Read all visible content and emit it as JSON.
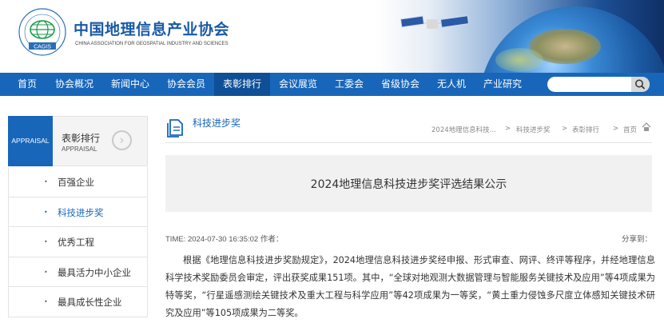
{
  "header": {
    "title": "中国地理信息产业协会",
    "subtitle": "CHINA ASSOCIATION FOR GEOSPATIAL INDUSTRY AND SCIENCES",
    "logo_text": "CAGIS"
  },
  "nav": {
    "items": [
      "首页",
      "协会概况",
      "新闻中心",
      "协会会员",
      "表彰排行",
      "会议展览",
      "工委会",
      "省级协会",
      "无人机",
      "产业研究"
    ],
    "active_index": 4,
    "search_placeholder": ""
  },
  "sidebar": {
    "en_block": "APPRAISAL",
    "title": "表彰排行",
    "title_en": "APPRAISAL",
    "items": [
      {
        "label": "百强企业",
        "active": false
      },
      {
        "label": "科技进步奖",
        "active": true
      },
      {
        "label": "优秀工程",
        "active": false
      },
      {
        "label": "最具活力中小企业",
        "active": false
      },
      {
        "label": "最具成长性企业",
        "active": false
      }
    ]
  },
  "main": {
    "section_title": "科技进步奖",
    "breadcrumb": [
      "2024地理信息科技...",
      "科技进步奖",
      "表彰排行",
      "首页"
    ],
    "article_title": "2024地理信息科技进步奖评选结果公示",
    "meta": "TIME: 2024-07-30 16:35:02 作者：",
    "share_label": "分享到：",
    "body": "根据《地理信息科技进步奖励规定》，2024地理信息科技进步奖经申报、形式审查、网评、终评等程序，并经地理信息科学技术奖励委员会审定，评出获奖成果151项。其中，“全球对地观测大数据管理与智能服务关键技术及应用”等4项成果为特等奖，“行星遥感测绘关键技术及重大工程与科学应用”等42项成果为一等奖，“黄土重力侵蚀多尺度立体感知关键技术研究及应用”等105项成果为二等奖。"
  },
  "colors": {
    "brand_blue": "#1766ba",
    "nav_active": "#0e4f96"
  }
}
